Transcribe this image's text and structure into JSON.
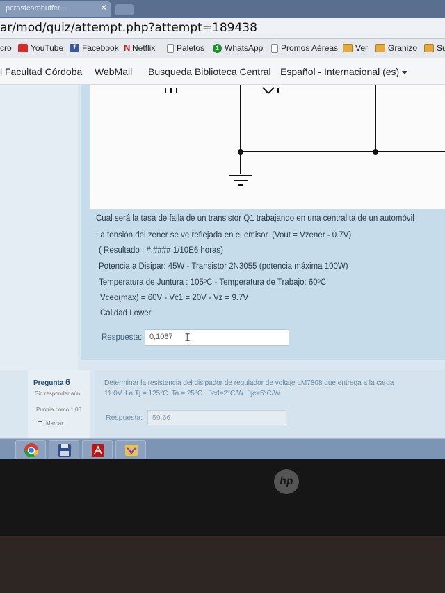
{
  "browser": {
    "tab_title": "pcrosfcambuffer...",
    "tab_close": "✕",
    "url": "ar/mod/quiz/attempt.php?attempt=189438",
    "bookmarks": [
      "cro",
      "YouTube",
      "Facebook",
      "Netflix",
      "Paletos",
      "WhatsApp",
      "Promos Aéreas",
      "Ver",
      "Granizo",
      "Su"
    ]
  },
  "site_nav": {
    "items": [
      "l Facultad Córdoba",
      "WebMail",
      "Busqueda Biblioteca Central"
    ],
    "language": "Español - Internacional (es)"
  },
  "question5": {
    "lines": [
      "Cual será la tasa de falla de un transistor Q1 trabajando en una centralita de un automóvil",
      "La tensión del zener se ve reflejada en el emisor. (Vout = Vzener - 0.7V)",
      "( Resultado : #,####  1/10E6 horas)",
      "Potencia a Disipar: 45W - Transistor 2N3055 (potencia máxima 100W)",
      "Temperatura de Juntura : 105ºC  - Temperatura de Trabajo: 60ºC",
      "Vceo(max) = 60V - Vc1 = 20V - Vz = 9.7V",
      "Calidad Lower"
    ],
    "answer_label": "Respuesta:",
    "answer_value": "0,1087"
  },
  "question6": {
    "label": "Pregunta",
    "number": "6",
    "status": "Sin responder aún",
    "points": "Puntúa como 1,00",
    "flag": "Marcar",
    "lines": [
      "Determinar la resistencia del disipador de regulador de voltaje LM7808 que entrega a la carga",
      "11.0V. La Tj = 125°C. Ta = 25°C . θcd=2°C/W. θjc=5°C/W"
    ],
    "answer_label": "Respuesta:",
    "answer_value": "59.66"
  },
  "laptop": {
    "logo": "hp"
  }
}
